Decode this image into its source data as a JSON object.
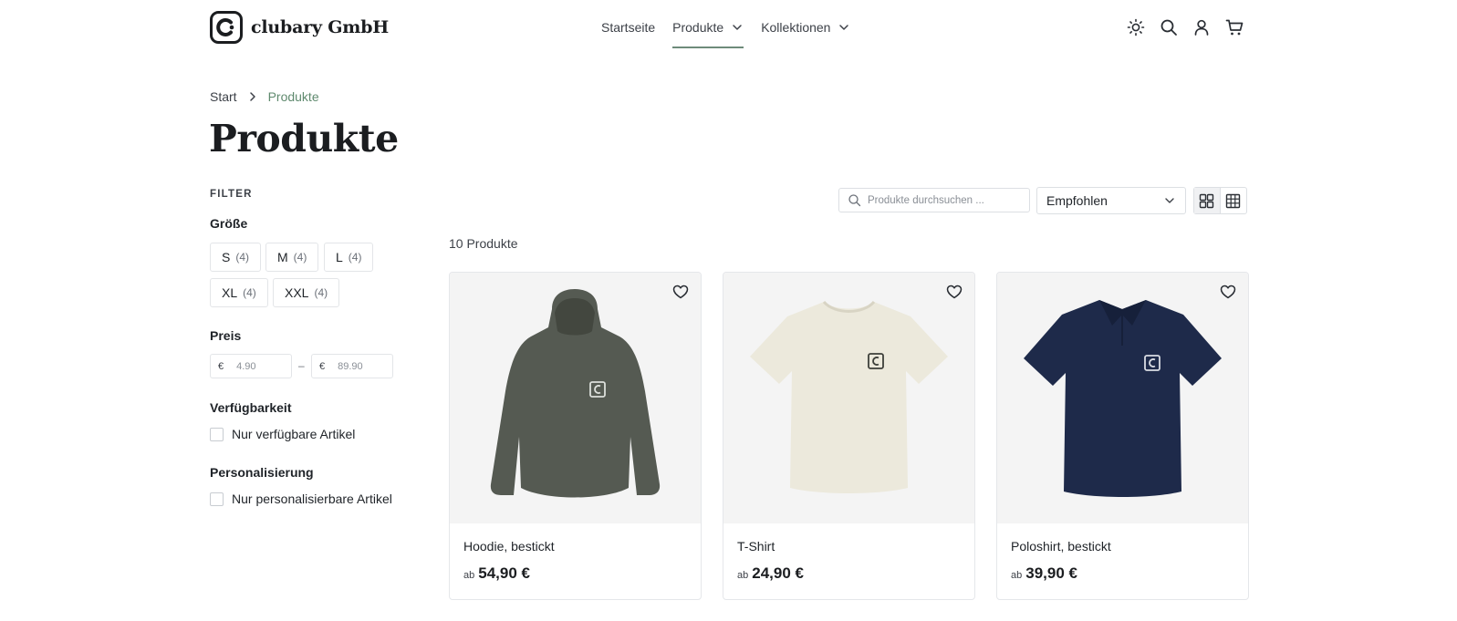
{
  "brand": {
    "name": "clubary GmbH",
    "logo_icon": "clubary-logo-icon"
  },
  "nav": {
    "items": [
      {
        "label": "Startseite",
        "active": false,
        "dropdown": false
      },
      {
        "label": "Produkte",
        "active": true,
        "dropdown": true
      },
      {
        "label": "Kollektionen",
        "active": false,
        "dropdown": true
      }
    ]
  },
  "header_icons": [
    "sun-icon",
    "search-icon",
    "user-icon",
    "cart-icon"
  ],
  "breadcrumb": {
    "start": "Start",
    "current": "Produkte"
  },
  "page_title": "Produkte",
  "filter": {
    "heading": "FILTER",
    "size": {
      "title": "Größe",
      "options": [
        {
          "label": "S",
          "count": "(4)"
        },
        {
          "label": "M",
          "count": "(4)"
        },
        {
          "label": "L",
          "count": "(4)"
        },
        {
          "label": "XL",
          "count": "(4)"
        },
        {
          "label": "XXL",
          "count": "(4)"
        }
      ]
    },
    "price": {
      "title": "Preis",
      "currency": "€",
      "min": "4.90",
      "max": "89.90",
      "separator": "–"
    },
    "availability": {
      "title": "Verfügbarkeit",
      "label": "Nur verfügbare Artikel",
      "checked": false
    },
    "personalization": {
      "title": "Personalisierung",
      "label": "Nur personalisierbare Artikel",
      "checked": false
    }
  },
  "toolbar": {
    "search_placeholder": "Produkte durchsuchen ...",
    "sort_selected": "Empfohlen",
    "view_modes": [
      "grid-large-icon",
      "grid-small-icon"
    ]
  },
  "product_count": "10 Produkte",
  "products": [
    {
      "name": "Hoodie, bestickt",
      "price_prefix": "ab",
      "price": "54,90 €",
      "color": "#555a52"
    },
    {
      "name": "T-Shirt",
      "price_prefix": "ab",
      "price": "24,90 €",
      "color": "#ece9dc"
    },
    {
      "name": "Poloshirt, bestickt",
      "price_prefix": "ab",
      "price": "39,90 €",
      "color": "#1e2a4a"
    }
  ],
  "colors": {
    "accent": "#5f8a6e",
    "text": "#1f2328",
    "border": "#e3e5e8"
  }
}
